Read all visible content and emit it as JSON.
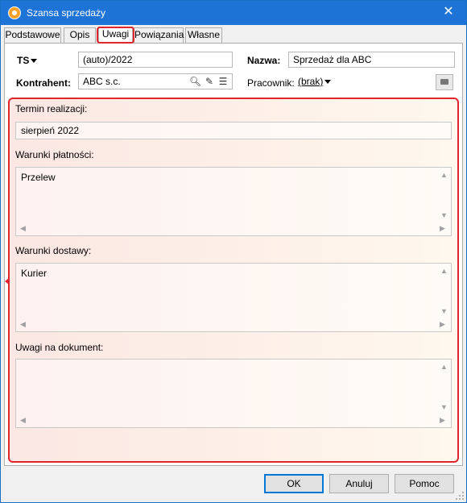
{
  "window": {
    "title": "Szansa sprzedaży",
    "close_symbol": "✕"
  },
  "tabs": [
    {
      "label": "Podstawowe"
    },
    {
      "label": "Opis"
    },
    {
      "label": "Uwagi"
    },
    {
      "label": "Powiązania"
    },
    {
      "label": "Własne"
    }
  ],
  "active_tab": "Uwagi",
  "header": {
    "ts_label": "TS",
    "ts_value": "(auto)/2022",
    "nazwa_label": "Nazwa:",
    "nazwa_value": "Sprzedaż dla ABC",
    "kontrahent_label": "Kontrahent:",
    "kontrahent_value": "ABC s.c.",
    "pracownik_label": "Pracownik:",
    "pracownik_value": "(brak)"
  },
  "notes": {
    "termin_label": "Termin realizacji:",
    "termin_value": "sierpień 2022",
    "platnosci_label": "Warunki płatności:",
    "platnosci_value": "Przelew",
    "dostawy_label": "Warunki dostawy:",
    "dostawy_value": "Kurier",
    "uwagi_label": "Uwagi na dokument:",
    "uwagi_value": ""
  },
  "buttons": {
    "ok": "OK",
    "cancel": "Anuluj",
    "help": "Pomoc"
  },
  "colors": {
    "titlebar": "#1e73d6",
    "highlight": "#e0262b"
  }
}
